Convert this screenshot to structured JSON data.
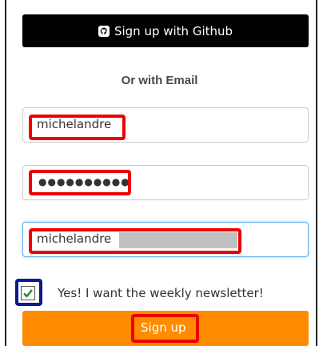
{
  "github_button": {
    "label": "Sign up with Github",
    "icon": "github-icon"
  },
  "divider_text": "Or with Email",
  "fields": {
    "username": {
      "value": "michelandre"
    },
    "password": {
      "value": "●●●●●●●●●●"
    },
    "email": {
      "value": "michelandre"
    }
  },
  "newsletter": {
    "checked": true,
    "label": "Yes! I want the weekly newsletter!"
  },
  "signup_button": {
    "label": "Sign up"
  },
  "colors": {
    "github_bg": "#000000",
    "signup_bg": "#ff8c00",
    "highlight_red": "#ee0000",
    "highlight_blue": "#0a1a8c",
    "focus_border": "#66afe9"
  }
}
